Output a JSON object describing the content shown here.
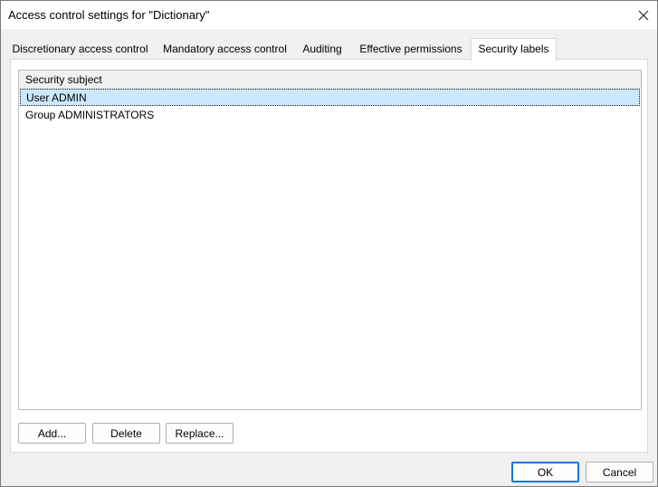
{
  "window": {
    "title": "Access control settings for \"Dictionary\""
  },
  "tabs": [
    {
      "label": "Discretionary access control"
    },
    {
      "label": "Mandatory access control"
    },
    {
      "label": "Auditing"
    },
    {
      "label": "Effective permissions"
    },
    {
      "label": "Security labels",
      "active": true
    }
  ],
  "subjects": {
    "column_header": "Security subject",
    "rows": [
      {
        "label": "User ADMIN",
        "selected": true
      },
      {
        "label": "Group ADMINISTRATORS",
        "selected": false
      }
    ]
  },
  "actions": {
    "add": "Add...",
    "delete": "Delete",
    "replace": "Replace..."
  },
  "footer": {
    "ok": "OK",
    "cancel": "Cancel"
  },
  "colors": {
    "selection": "#cce8ff",
    "default_button_border": "#0078d7"
  },
  "icons": {
    "close": "close-icon"
  }
}
